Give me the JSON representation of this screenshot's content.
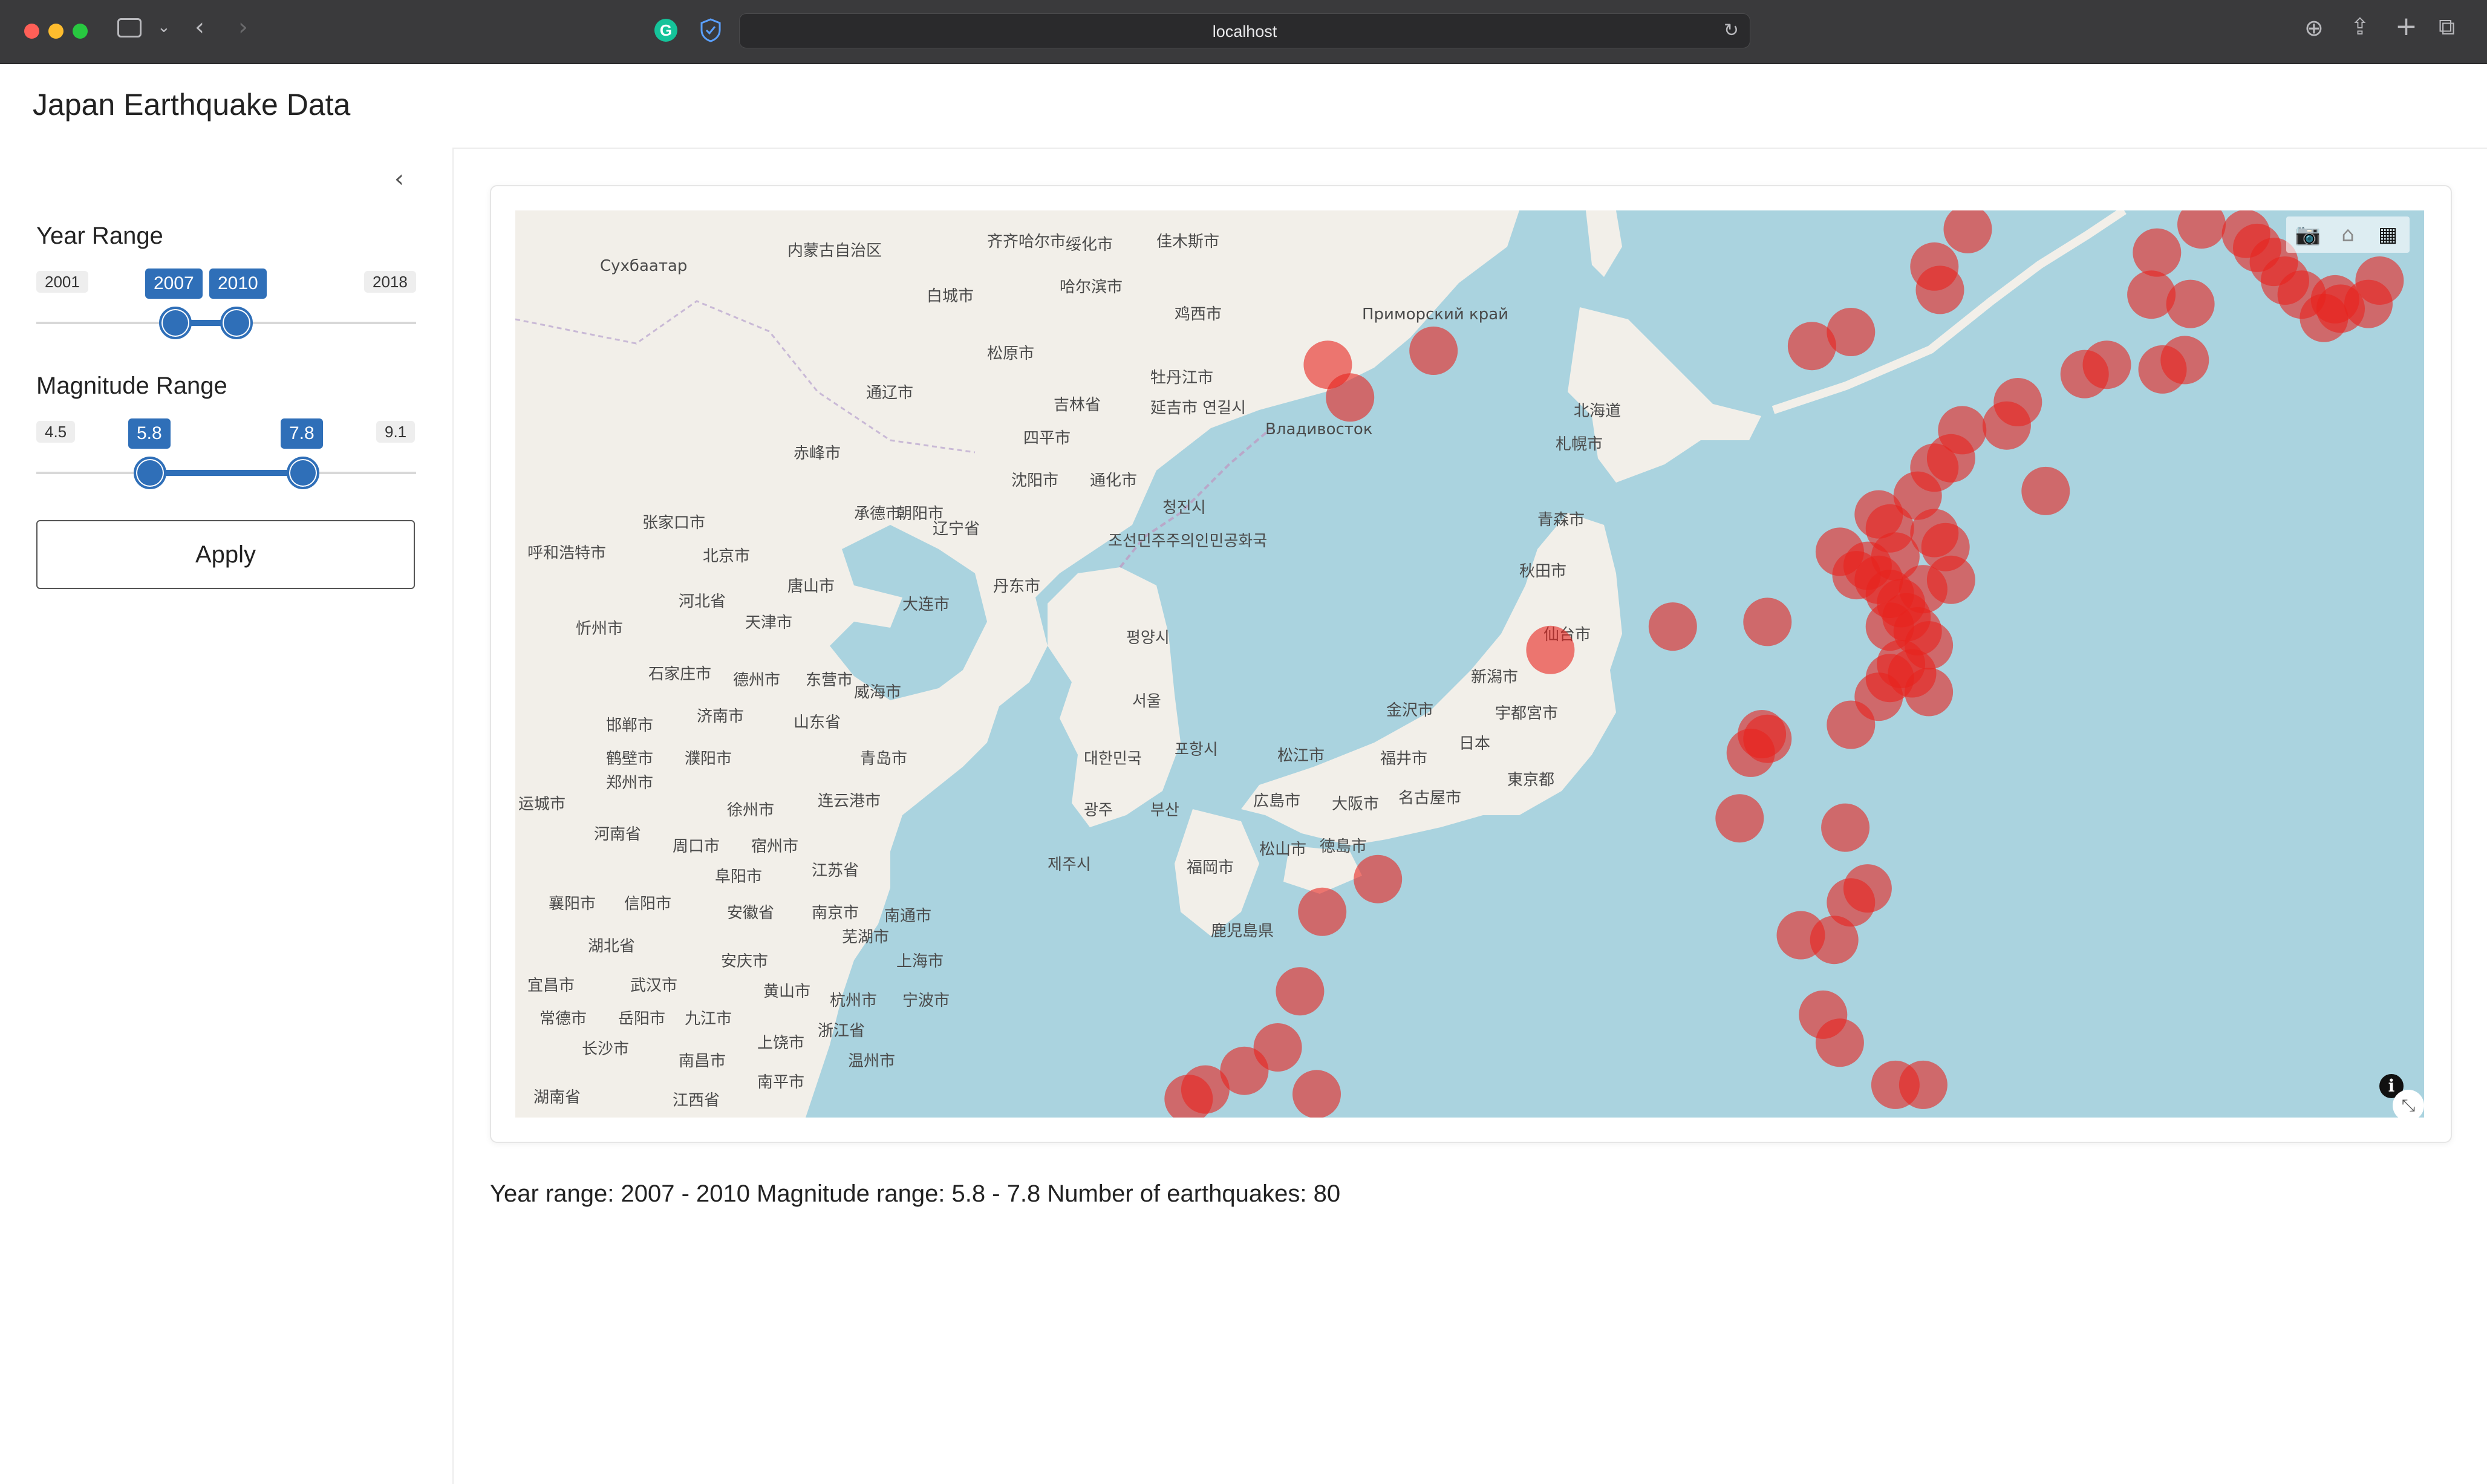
{
  "browser": {
    "url": "localhost"
  },
  "app": {
    "title": "Japan Earthquake Data"
  },
  "sidebar": {
    "year_range": {
      "label": "Year Range",
      "min": "2001",
      "max": "2018",
      "low": "2007",
      "high": "2010",
      "min_value": 2001,
      "max_value": 2018,
      "low_value": 2007,
      "high_value": 2010
    },
    "magnitude_range": {
      "label": "Magnitude Range",
      "min": "4.5",
      "max": "9.1",
      "low": "5.8",
      "high": "7.8",
      "min_value": 4.5,
      "max_value": 9.1,
      "low_value": 5.8,
      "high_value": 7.8
    },
    "apply_label": "Apply",
    "accent_color": "#2f6fb8"
  },
  "map": {
    "marker_color": "#e8231e",
    "water_color": "#aad3df",
    "land_color": "#f2efe9",
    "toolbar_icons": [
      "camera-icon",
      "home-icon",
      "plotly-logo-icon"
    ],
    "labels": [
      {
        "text": "齐齐哈尔市"
      },
      {
        "text": "绥化市"
      },
      {
        "text": "佳木斯市"
      },
      {
        "text": "哈尔滨市"
      },
      {
        "text": "鸡西市"
      },
      {
        "text": "白城市"
      },
      {
        "text": "松原市"
      },
      {
        "text": "牡丹江市"
      },
      {
        "text": "延吉市 연길시"
      },
      {
        "text": "Владивосток"
      },
      {
        "text": "Приморский край"
      },
      {
        "text": "通辽市"
      },
      {
        "text": "四平市"
      },
      {
        "text": "赤峰市"
      },
      {
        "text": "沈阳市"
      },
      {
        "text": "通化市"
      },
      {
        "text": "청진시"
      },
      {
        "text": "承德市"
      },
      {
        "text": "朝阳市"
      },
      {
        "text": "张家口市"
      },
      {
        "text": "辽宁省"
      },
      {
        "text": "조선민주주의인민공화국"
      },
      {
        "text": "呼和浩特市"
      },
      {
        "text": "北京市"
      },
      {
        "text": "丹东市"
      },
      {
        "text": "唐山市"
      },
      {
        "text": "大连市"
      },
      {
        "text": "河北省"
      },
      {
        "text": "天津市"
      },
      {
        "text": "평양시"
      },
      {
        "text": "忻州市"
      },
      {
        "text": "石家庄市"
      },
      {
        "text": "德州市"
      },
      {
        "text": "东营市"
      },
      {
        "text": "威海市"
      },
      {
        "text": "서울"
      },
      {
        "text": "济南市"
      },
      {
        "text": "山东省"
      },
      {
        "text": "邯郸市"
      },
      {
        "text": "鹤壁市"
      },
      {
        "text": "濮阳市"
      },
      {
        "text": "青岛市"
      },
      {
        "text": "포항시"
      },
      {
        "text": "대한민국"
      },
      {
        "text": "郑州市"
      },
      {
        "text": "连云港市"
      },
      {
        "text": "광주"
      },
      {
        "text": "부산"
      },
      {
        "text": "运城市"
      },
      {
        "text": "徐州市"
      },
      {
        "text": "河南省"
      },
      {
        "text": "周口市"
      },
      {
        "text": "宿州市"
      },
      {
        "text": "제주시"
      },
      {
        "text": "阜阳市"
      },
      {
        "text": "江苏省"
      },
      {
        "text": "襄阳市"
      },
      {
        "text": "信阳市"
      },
      {
        "text": "南京市"
      },
      {
        "text": "南通市"
      },
      {
        "text": "安徽省"
      },
      {
        "text": "湖北省"
      },
      {
        "text": "芜湖市"
      },
      {
        "text": "上海市"
      },
      {
        "text": "安庆市"
      },
      {
        "text": "宜昌市"
      },
      {
        "text": "武汉市"
      },
      {
        "text": "黄山市"
      },
      {
        "text": "杭州市"
      },
      {
        "text": "宁波市"
      },
      {
        "text": "常德市"
      },
      {
        "text": "岳阳市"
      },
      {
        "text": "九江市"
      },
      {
        "text": "浙江省"
      },
      {
        "text": "长沙市"
      },
      {
        "text": "上饶市"
      },
      {
        "text": "南昌市"
      },
      {
        "text": "温州市"
      },
      {
        "text": "南平市"
      },
      {
        "text": "江西省"
      },
      {
        "text": "湖南省"
      },
      {
        "text": "北海道"
      },
      {
        "text": "札幌市"
      },
      {
        "text": "青森市"
      },
      {
        "text": "秋田市"
      },
      {
        "text": "仙台市"
      },
      {
        "text": "新潟市"
      },
      {
        "text": "金沢市"
      },
      {
        "text": "宇都宮市"
      },
      {
        "text": "日本"
      },
      {
        "text": "松江市"
      },
      {
        "text": "福井市"
      },
      {
        "text": "東京都"
      },
      {
        "text": "広島市"
      },
      {
        "text": "大阪市"
      },
      {
        "text": "名古屋市"
      },
      {
        "text": "福岡市"
      },
      {
        "text": "松山市"
      },
      {
        "text": "徳島市"
      },
      {
        "text": "鹿児島県"
      },
      {
        "text": "Сухбаатар"
      },
      {
        "text": "内蒙古自治区"
      },
      {
        "text": "吉林省"
      }
    ],
    "quakes": [
      {
        "lon": 142.0,
        "lat": 45.0
      },
      {
        "lon": 142.1,
        "lat": 44.5
      },
      {
        "lon": 140.5,
        "lat": 43.6
      },
      {
        "lon": 139.8,
        "lat": 43.3
      },
      {
        "lon": 133.0,
        "lat": 43.2
      },
      {
        "lon": 131.1,
        "lat": 42.9
      },
      {
        "lon": 131.5,
        "lat": 42.2
      },
      {
        "lon": 145.9,
        "lat": 44.4
      },
      {
        "lon": 146.6,
        "lat": 44.2
      },
      {
        "lon": 147.8,
        "lat": 45.4
      },
      {
        "lon": 148.1,
        "lat": 45.1
      },
      {
        "lon": 148.3,
        "lat": 44.7
      },
      {
        "lon": 148.6,
        "lat": 44.4
      },
      {
        "lon": 149.2,
        "lat": 44.3
      },
      {
        "lon": 149.3,
        "lat": 44.1
      },
      {
        "lon": 149.0,
        "lat": 43.9
      },
      {
        "lon": 150.0,
        "lat": 44.7
      },
      {
        "lon": 149.8,
        "lat": 44.2
      },
      {
        "lon": 145.1,
        "lat": 42.9
      },
      {
        "lon": 144.7,
        "lat": 42.7
      },
      {
        "lon": 146.1,
        "lat": 42.8
      },
      {
        "lon": 146.5,
        "lat": 43.0
      },
      {
        "lon": 143.5,
        "lat": 42.1
      },
      {
        "lon": 142.5,
        "lat": 41.5
      },
      {
        "lon": 142.3,
        "lat": 40.9
      },
      {
        "lon": 142.0,
        "lat": 40.7
      },
      {
        "lon": 141.7,
        "lat": 40.1
      },
      {
        "lon": 141.2,
        "lat": 39.4
      },
      {
        "lon": 142.0,
        "lat": 39.3
      },
      {
        "lon": 142.2,
        "lat": 39.0
      },
      {
        "lon": 141.3,
        "lat": 38.8
      },
      {
        "lon": 140.8,
        "lat": 38.6
      },
      {
        "lon": 141.0,
        "lat": 38.3
      },
      {
        "lon": 142.3,
        "lat": 38.3
      },
      {
        "lon": 141.8,
        "lat": 38.1
      },
      {
        "lon": 141.5,
        "lat": 37.5
      },
      {
        "lon": 141.7,
        "lat": 37.2
      },
      {
        "lon": 141.9,
        "lat": 36.9
      },
      {
        "lon": 141.4,
        "lat": 36.5
      },
      {
        "lon": 141.2,
        "lat": 36.2
      },
      {
        "lon": 141.0,
        "lat": 35.8
      },
      {
        "lon": 140.5,
        "lat": 35.2
      },
      {
        "lon": 139.0,
        "lat": 37.4
      },
      {
        "lon": 137.3,
        "lat": 37.3
      },
      {
        "lon": 135.1,
        "lat": 36.8
      },
      {
        "lon": 139.0,
        "lat": 34.9
      },
      {
        "lon": 138.7,
        "lat": 34.6
      },
      {
        "lon": 138.5,
        "lat": 33.2
      },
      {
        "lon": 140.4,
        "lat": 33.0
      },
      {
        "lon": 140.8,
        "lat": 31.7
      },
      {
        "lon": 140.5,
        "lat": 31.4
      },
      {
        "lon": 140.2,
        "lat": 30.6
      },
      {
        "lon": 139.6,
        "lat": 30.7
      },
      {
        "lon": 132.0,
        "lat": 31.9
      },
      {
        "lon": 131.0,
        "lat": 31.2
      },
      {
        "lon": 130.6,
        "lat": 29.5
      },
      {
        "lon": 140.0,
        "lat": 29.0
      },
      {
        "lon": 140.3,
        "lat": 28.4
      },
      {
        "lon": 130.2,
        "lat": 28.3
      },
      {
        "lon": 129.6,
        "lat": 27.8
      },
      {
        "lon": 128.9,
        "lat": 27.4
      },
      {
        "lon": 128.6,
        "lat": 27.2
      },
      {
        "lon": 141.3,
        "lat": 27.5
      },
      {
        "lon": 141.8,
        "lat": 27.5
      },
      {
        "lon": 146.0,
        "lat": 45.3
      },
      {
        "lon": 146.8,
        "lat": 45.9
      },
      {
        "lon": 147.6,
        "lat": 45.7
      },
      {
        "lon": 141.0,
        "lat": 39.7
      },
      {
        "lon": 140.3,
        "lat": 38.9
      },
      {
        "lon": 141.4,
        "lat": 37.8
      },
      {
        "lon": 141.2,
        "lat": 37.3
      },
      {
        "lon": 141.6,
        "lat": 36.3
      },
      {
        "lon": 141.9,
        "lat": 35.9
      },
      {
        "lon": 142.6,
        "lat": 45.8
      },
      {
        "lon": 143.3,
        "lat": 41.6
      },
      {
        "lon": 144.0,
        "lat": 40.2
      },
      {
        "lon": 138.9,
        "lat": 35.0
      },
      {
        "lon": 140.6,
        "lat": 38.4
      },
      {
        "lon": 141.2,
        "lat": 38.0
      },
      {
        "lon": 130.9,
        "lat": 27.3
      }
    ]
  },
  "summary": {
    "text": "Year range: 2007 - 2010 Magnitude range: 5.8 - 7.8 Number of earthquakes: 80"
  }
}
